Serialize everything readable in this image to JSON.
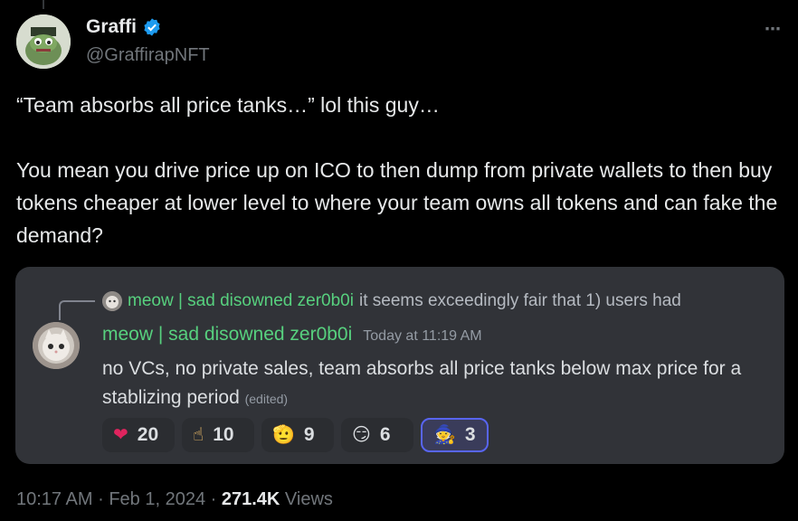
{
  "author": {
    "name": "Graffi",
    "handle": "@GraffirapNFT",
    "verified_color": "#1d9bf0"
  },
  "tweet": {
    "line1": "“Team absorbs all price tanks…” lol this guy…",
    "line2": "You mean you drive price up on ICO to then dump from private wallets to then buy tokens cheaper at lower level to where your team owns all tokens and can fake the demand?"
  },
  "embed": {
    "reply": {
      "name": "meow | sad disowned zer0b0i",
      "text": "it seems exceedingly fair that 1) users had"
    },
    "message": {
      "name": "meow | sad disowned zer0b0i",
      "time": "Today at 11:19 AM",
      "body": "no VCs, no private sales, team absorbs all price tanks below max price for a stablizing period",
      "edited": "(edited)"
    },
    "reactions": [
      {
        "emoji": "❤",
        "icon": "heart-icon",
        "count": "20"
      },
      {
        "emoji": "☝",
        "icon": "point-up-icon",
        "count": "10"
      },
      {
        "emoji": "🫡",
        "icon": "salute-icon",
        "count": "9"
      },
      {
        "emoji": "😏",
        "icon": "smirk-icon",
        "count": "6"
      },
      {
        "emoji": "🧙",
        "icon": "wizard-icon",
        "count": "3"
      }
    ]
  },
  "meta": {
    "time": "10:17 AM",
    "sep1": "·",
    "date": "Feb 1, 2024",
    "sep2": "·",
    "views_count": "271.4K",
    "views_label": "Views"
  },
  "icons": {
    "more": "⋯"
  },
  "colors": {
    "background": "#000000",
    "embed_background": "#313338",
    "discord_green_name": "#57d07e",
    "active_reaction_border": "#5865f2"
  }
}
